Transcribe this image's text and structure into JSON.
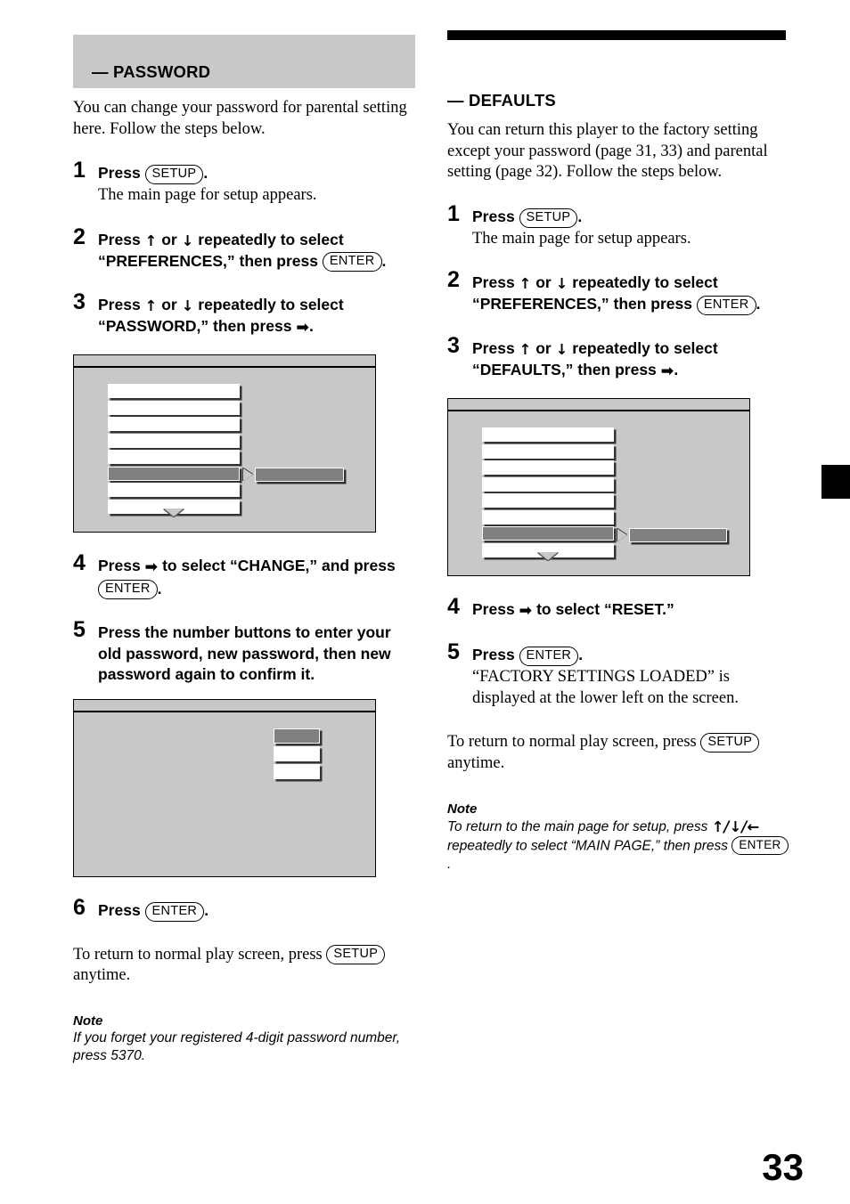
{
  "page": {
    "folio": "33",
    "edge_tab_color": "#000000",
    "band_color": "#c8c8c8"
  },
  "left_column": {
    "section_title": "— PASSWORD",
    "intro": "You can change your password for parental setting here. Follow the steps below.",
    "steps": [
      {
        "num": "1",
        "lead_pre": "Press ",
        "key1": "SETUP",
        "lead_post": ".",
        "sub": "The main page for setup appears."
      },
      {
        "num": "2",
        "lead_pre": "Press ",
        "arrow_up": "↑",
        "lead_mid": " or ",
        "arrow_down": "↓",
        "lead_post": " repeatedly to select “PREFERENCES,” then press ",
        "key1": "ENTER",
        "lead_end": "."
      },
      {
        "num": "3",
        "lead_pre": "Press ",
        "arrow_up": "↑",
        "lead_mid": " or ",
        "arrow_down": "↓",
        "lead_post": " repeatedly to select “PASSWORD,” then press ",
        "arrow_right": "➡",
        "lead_end": "."
      },
      {
        "num": "4",
        "lead_pre": "Press ",
        "arrow_right": "➡",
        "lead_post": " to select “CHANGE,” and press ",
        "key1": "ENTER",
        "lead_end": "."
      },
      {
        "num": "5",
        "lead_pre": "Press the number buttons to enter your old password, new password, then new password again to confirm it."
      },
      {
        "num": "6",
        "lead_pre": "Press ",
        "key1": "ENTER",
        "lead_post": "."
      }
    ],
    "closing_pre": "To return to normal play screen, press ",
    "closing_key": "SETUP",
    "closing_post": " anytime.",
    "note_label": "Note",
    "note_text": "If you forget your registered 4-digit password number, press 5370."
  },
  "right_column": {
    "section_title": "— DEFAULTS",
    "intro": "You can return this player to the factory setting except your password (page 31, 33) and parental setting (page 32). Follow the steps below.",
    "steps": [
      {
        "num": "1",
        "lead_pre": "Press ",
        "key1": "SETUP",
        "lead_post": ".",
        "sub": "The main page for setup appears."
      },
      {
        "num": "2",
        "lead_pre": "Press ",
        "arrow_up": "↑",
        "lead_mid": " or ",
        "arrow_down": "↓",
        "lead_post": " repeatedly to select “PREFERENCES,” then press ",
        "key1": "ENTER",
        "lead_end": "."
      },
      {
        "num": "3",
        "lead_pre": "Press ",
        "arrow_up": "↑",
        "lead_mid": " or ",
        "arrow_down": "↓",
        "lead_post": " repeatedly to select “DEFAULTS,” then press ",
        "arrow_right": "➡",
        "lead_end": "."
      },
      {
        "num": "4",
        "lead_pre": "Press ",
        "arrow_right": "➡",
        "lead_post": " to select “RESET.”"
      },
      {
        "num": "5",
        "lead_pre": "Press ",
        "key1": "ENTER",
        "lead_post": ".",
        "sub": "“FACTORY SETTINGS LOADED” is displayed at the lower left on the screen."
      }
    ],
    "closing_pre": "To return to normal play screen, press ",
    "closing_key": "SETUP",
    "closing_post": " anytime.",
    "note_label": "Note",
    "note_pre": "To return to the main page for setup, press ",
    "note_arrows": "↑/↓/←",
    "note_mid": " repeatedly to select “MAIN PAGE,” then press ",
    "note_key": "ENTER",
    "note_end": "."
  },
  "diagrams": {
    "menu_password": {
      "rows": 8,
      "selected_index": 6,
      "has_option_bar": true,
      "has_scroll_down": true
    },
    "password_entry": {
      "boxes": 3,
      "selected_index": 1
    },
    "menu_defaults": {
      "rows": 8,
      "selected_index": 7,
      "has_option_bar": true,
      "has_scroll_down": true
    }
  }
}
